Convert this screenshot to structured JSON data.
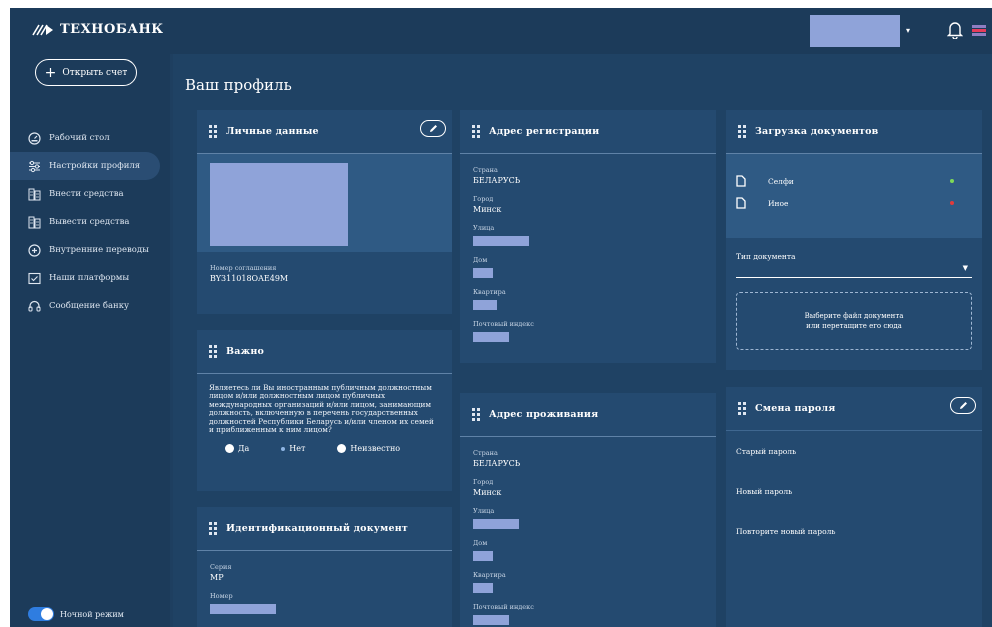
{
  "brand": {
    "name": "ТЕХНОБАНК"
  },
  "header": {
    "user_caret": "▾"
  },
  "sidebar": {
    "open_account": "Открыть счет",
    "items": [
      {
        "label": "Рабочий стол",
        "icon": "dashboard-icon"
      },
      {
        "label": "Настройки профиля",
        "icon": "sliders-icon",
        "active": true
      },
      {
        "label": "Внести средства",
        "icon": "deposit-icon"
      },
      {
        "label": "Вывести средства",
        "icon": "withdraw-icon"
      },
      {
        "label": "Внутренние переводы",
        "icon": "transfer-icon"
      },
      {
        "label": "Наши платформы",
        "icon": "platform-icon"
      },
      {
        "label": "Сообщение банку",
        "icon": "headset-icon"
      }
    ],
    "night_mode": "Ночной режим",
    "night_mode_on": true
  },
  "page": {
    "title": "Ваш профиль"
  },
  "personal": {
    "title": "Личные данные",
    "agreement_label": "Номер соглашения",
    "agreement_value": "BY311018OAE49M"
  },
  "important": {
    "title": "Важно",
    "text": "Являетесь ли Вы иностранным публичным должностным лицом и/или должностным лицом публичных международных организаций и/или лицом, занимающим должность, включенную в перечень государственных должностей Республики Беларусь и/или членом их семей и приближенным к ним лицом?",
    "options": [
      "Да",
      "Нет",
      "Неизвестно"
    ],
    "selected": "Нет"
  },
  "id_doc": {
    "title": "Идентификационный документ",
    "series_label": "Серия",
    "series_value": "МР",
    "number_label": "Номер"
  },
  "registration": {
    "title": "Адрес регистрации",
    "country_label": "Страна",
    "country_value": "БЕЛАРУСЬ",
    "city_label": "Город",
    "city_value": "Минск",
    "street_label": "Улица",
    "house_label": "Дом",
    "apartment_label": "Квартира",
    "postal_label": "Почтовый индекс"
  },
  "residence": {
    "title": "Адрес проживания",
    "country_label": "Страна",
    "country_value": "БЕЛАРУСЬ",
    "city_label": "Город",
    "city_value": "Минск",
    "street_label": "Улица",
    "house_label": "Дом",
    "apartment_label": "Квартира",
    "postal_label": "Почтовый индекс"
  },
  "documents": {
    "title": "Загрузка документов",
    "items": [
      {
        "label": "Селфи",
        "status_color": "#7ed957"
      },
      {
        "label": "Иное",
        "status_color": "#e23b3b"
      }
    ],
    "type_label": "Тип документа",
    "drop_line1": "Выберите файл документа",
    "drop_line2": "или перетащите его сюда"
  },
  "password": {
    "title": "Смена пароля",
    "old": "Старый пароль",
    "new": "Новый пароль",
    "repeat": "Повторите новый пароль"
  }
}
